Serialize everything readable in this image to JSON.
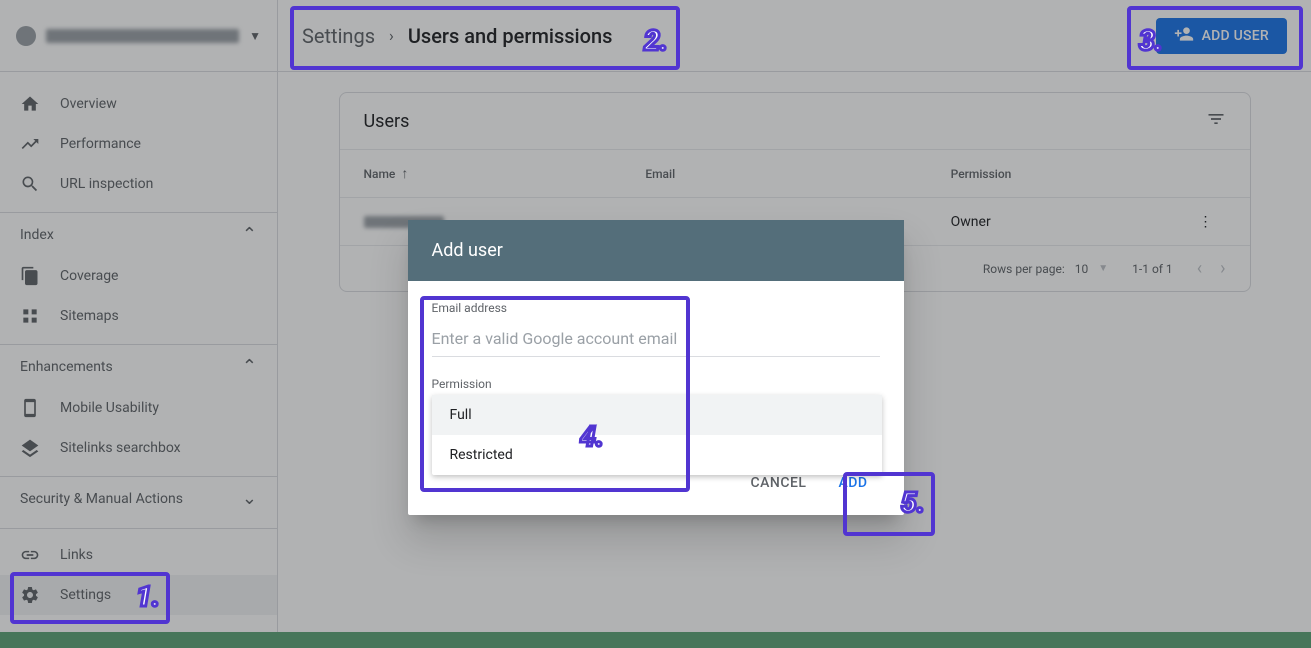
{
  "breadcrumb": {
    "root": "Settings",
    "current": "Users and permissions"
  },
  "header": {
    "add_user_label": "ADD USER"
  },
  "sidebar": {
    "overview": "Overview",
    "performance": "Performance",
    "url_inspection": "URL inspection",
    "section_index": "Index",
    "coverage": "Coverage",
    "sitemaps": "Sitemaps",
    "section_enhancements": "Enhancements",
    "mobile_usability": "Mobile Usability",
    "sitelinks_searchbox": "Sitelinks searchbox",
    "section_security": "Security & Manual Actions",
    "links": "Links",
    "settings": "Settings"
  },
  "card": {
    "title": "Users",
    "col_name": "Name",
    "col_email": "Email",
    "col_permission": "Permission",
    "row_permission": "Owner",
    "rows_per_page_label": "Rows per page:",
    "rows_per_page_value": "10",
    "range": "1-1 of 1"
  },
  "dialog": {
    "title": "Add user",
    "email_label": "Email address",
    "email_placeholder": "Enter a valid Google account email",
    "permission_label": "Permission",
    "option_full": "Full",
    "option_restricted": "Restricted",
    "cancel": "CANCEL",
    "add": "ADD"
  },
  "callouts": {
    "c1": "1.",
    "c2": "2.",
    "c3": "3.",
    "c4": "4.",
    "c5": "5."
  }
}
